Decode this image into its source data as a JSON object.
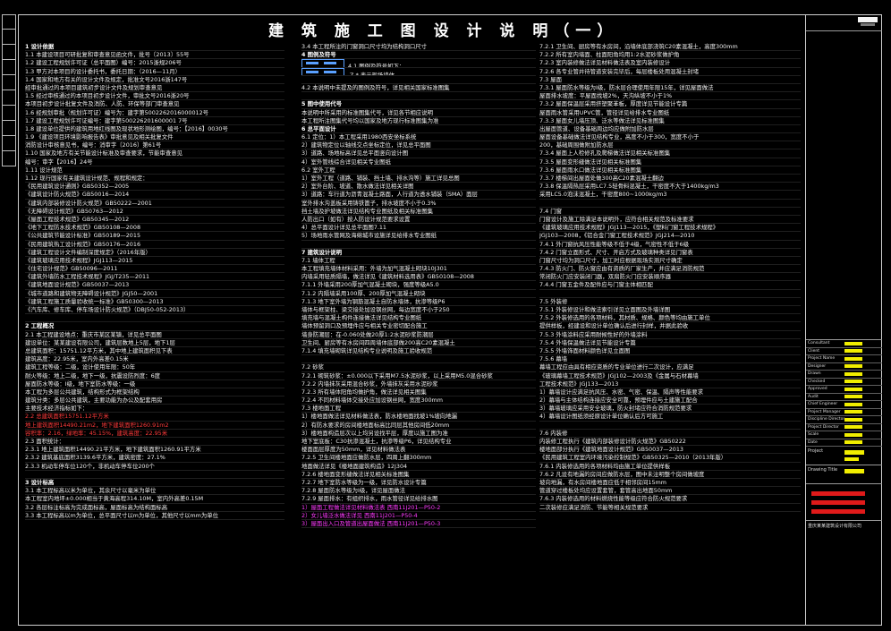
{
  "title": "建 筑 施 工 图 设 计 说 明（一）",
  "col1": [
    {
      "t": "1 设计依据",
      "c": "h"
    },
    {
      "t": "1.1 本建设项目可研批复和审查意见函文件，批号〔2013〕55号"
    },
    {
      "t": "1.2 建设工程规划许可证（总平面图）编号：2015浙规206号"
    },
    {
      "t": "1.3 甲方对本项目的设计委托书，委托日期：（2016—11月）"
    },
    {
      "t": "1.4 国家和地方有关的设计文件及规定，批准文号2016浙147号"
    },
    {
      "t": "  经审批通过的本项目建筑初步设计文件及规划审查意见"
    },
    {
      "t": "1.5 经过审核通过的本项目初步设计文件，审批文号2016浙20号"
    },
    {
      "t": "  本项目初步设计批复文件及消防、人防、环保等部门审查意见"
    },
    {
      "t": "1.6 经规划审批（规划许可证）编号为：建字第5002262016000012号"
    },
    {
      "t": "1.7 建设工程规划许可证编号：建字第500226201600001 7号"
    },
    {
      "t": "1.8 建设单位提供的建筑用地红线图及现状地形测绘图，编号：【2016】0030号"
    },
    {
      "t": "1.9 《建设项目环境影响报告表》审批意见及相关批复文件"
    },
    {
      "t": "  消防设计审核意见书，编号：消审字〔2016〕第61号"
    },
    {
      "t": "1.10 国家及地方有关节能设计标准及审查要求，节能审查意见"
    },
    {
      "t": "  编号：审字【2016】24号"
    },
    {
      "t": "1.11 设计规范"
    },
    {
      "t": "1.12 现行国家有关建筑设计规范、规程和规定："
    },
    {
      "t": "  《民用建筑设计通则》GB50352—2005"
    },
    {
      "t": "  《建筑设计防火规范》GB50016—2014"
    },
    {
      "t": "  《建筑内部装修设计防火规范》GB50222—2001"
    },
    {
      "t": "  《无障碍设计规范》GB50763—2012"
    },
    {
      "t": "  《屋面工程技术规范》GB50345—2012"
    },
    {
      "t": "  《地下工程防水技术规范》GB50108—2008"
    },
    {
      "t": "  《公共建筑节能设计标准》GB50189—2015"
    },
    {
      "t": "  《民用建筑热工设计规范》GB50176—2016"
    },
    {
      "t": "  《建筑工程设计文件编制深度规定》（2016年版）"
    },
    {
      "t": "  《建筑玻璃应用技术规程》JGJ113—2015"
    },
    {
      "t": "  《住宅设计规范》GB50096—2011"
    },
    {
      "t": "  《建筑外墙防水工程技术规程》JGJ/T235—2011"
    },
    {
      "t": "  《建筑地面设计规范》GB50037—2013"
    },
    {
      "t": "  《城市道路和建筑物无障碍设计规范》JGJ50—2001"
    },
    {
      "t": "  《建筑工程施工质量验收统一标准》GB50300—2013"
    },
    {
      "t": "  《汽车库、修车库、停车场设计防火规范》（DBJ50-052-2013）"
    },
    {
      "t": ""
    },
    {
      "t": "2 工程概况",
      "c": "h"
    },
    {
      "t": "2.1 本工程建设地点：重庆市某区某镇，详见总平面图"
    },
    {
      "t": "  建设单位：某某建设有限公司，建筑层数地上5层，地下1层"
    },
    {
      "t": "  总建筑面积：15751.12平方米，其中地上建筑面积见下表"
    },
    {
      "t": "  建筑高度：22.95米，室内外高差0.15米"
    },
    {
      "t": "  建筑工程等级：二级，设计使用年限：50年"
    },
    {
      "t": "  耐火等级：地上二级，地下一级，抗震设防烈度：6度"
    },
    {
      "t": "  屋面防水等级：Ⅰ级，地下室防水等级：一级"
    },
    {
      "t": "  本工程为多层公共建筑，结构形式为框架结构"
    },
    {
      "t": "  建筑分类：多层公共建筑，主要功能为办公及配套用房"
    },
    {
      "t": "  主要技术经济指标如下："
    },
    {
      "t": "2.2 总建筑面积15751.12平方米",
      "c": "r"
    },
    {
      "t": "  地上建筑面积14490.21m2，地下建筑面积1260.91m2",
      "c": "r"
    },
    {
      "t": "  容积率：2.16，绿地率：45.15%，建筑高度：22.95米",
      "c": "r"
    },
    {
      "t": "2.3 面积统计："
    },
    {
      "t": "  2.3.1 地上建筑面积14490.21平方米，地下建筑面积1260.91平方米"
    },
    {
      "t": "  2.3.2 建筑基底面积3139.6平方米，建筑密度：27.1%"
    },
    {
      "t": "  2.3.3 机动车停车位120个，非机动车停车位200个"
    },
    {
      "t": ""
    },
    {
      "t": "3 设计标高",
      "c": "h"
    },
    {
      "t": "3.1 本工程标高以米为单位，其余尺寸以毫米为单位"
    },
    {
      "t": "  本工程室内地坪±0.000相当于黄海高程314.10M，室内外高差0.15M"
    },
    {
      "t": "3.2 各层标注标高为完成面标高，屋面标高为结构面标高"
    },
    {
      "t": "3.3 本工程标高以m为单位，总平面尺寸以m为单位，其他尺寸以mm为单位"
    }
  ],
  "col2": [
    {
      "t": "3.4 本工程所注的门窗洞口尺寸均为结构洞口尺寸"
    },
    {
      "t": "4 图例及符号",
      "c": "h"
    },
    {
      "t": "4.1 图例及符号如下：",
      "sym": true
    },
    {
      "t": "  Z-* 表示现场墙体",
      "sym": true
    },
    {
      "t": ""
    },
    {
      "t": "4.2 本说明中未提及的图例及符号，详见相关国家标准图集"
    },
    {
      "t": ""
    },
    {
      "t": "5 图中使用代号",
      "c": "h"
    },
    {
      "t": "  本说明中所采用的标准图集代号，详见各节相应说明"
    },
    {
      "t": "  本工程所注图集代号均以国家及地方现行标准图集为准"
    },
    {
      "t": "6 总平面设计",
      "c": "h"
    },
    {
      "t": "6.1 定位：1）本工程采用1980西安坐标系统"
    },
    {
      "t": "  2）建筑物定位以轴线交点坐标定位，详见总平面图"
    },
    {
      "t": "  3）道路、场地标高详见总平面竖向设计图"
    },
    {
      "t": "  4）室外管线综合详见相关专业图纸"
    },
    {
      "t": "6.2 室外工程"
    },
    {
      "t": "  1）室外工程（道路、铺装、挡土墙、排水沟等）施工详见总图"
    },
    {
      "t": "  2）室外台阶、坡道、散水做法详见相关详图"
    },
    {
      "t": "  3）道路：车行道为沥青混凝土路面，人行道为透水铺装（SMA）面层"
    },
    {
      "t": "  室外排水沟盖板采用铸铁篦子，排水坡度不小于0.3%"
    },
    {
      "t": "  挡土墙及护坡做法详见结构专业图纸及相关标准图集"
    },
    {
      "t": "  人防出口（如有）按人防设计规范要求设置"
    },
    {
      "t": "  4）总平面设计详见总平面图7.11"
    },
    {
      "t": "  5）场地雨水管网及海绵城市设施详见给排水专业图纸"
    },
    {
      "t": ""
    },
    {
      "t": "7 建筑设计说明",
      "c": "h"
    },
    {
      "t": "7.1 墙体工程"
    },
    {
      "t": "  本工程填充墙体材料采用：外墙为加气混凝土砌块10J301"
    },
    {
      "t": "  内墙采用轻质隔墙，做法详见《建筑材料选用表》GB50108—2008"
    },
    {
      "t": "7.1.1 外墙采用200厚加气混凝土砌块，强度等级A5.0"
    },
    {
      "t": "7.1.2 内隔墙采用100厚、200厚加气混凝土砌块"
    },
    {
      "t": "7.1.3 地下室外墙为钢筋混凝土自防水墙体，抗渗等级P6"
    },
    {
      "t": "  墙体与框架柱、梁交接处加设钢丝网，每边宽度不小于250"
    },
    {
      "t": "  填充墙与混凝土构件连接做法详见结构专业图纸"
    },
    {
      "t": "  墙体预留洞口及预埋件应与相关专业密切配合施工"
    },
    {
      "t": "  墙身防潮层：在-0.060处做20厚1:2水泥砂浆防潮层"
    },
    {
      "t": "  卫生间、厨房等有水房间四周墙体底部做200高C20素混凝土"
    },
    {
      "t": "7.1.4 填充墙砌筑详见结构专业说明及施工验收规范"
    },
    {
      "t": ""
    },
    {
      "t": "7.2 砂浆"
    },
    {
      "t": "7.2.1 砌筑砂浆：±0.000以下采用M7.5水泥砂浆，以上采用M5.0混合砂浆"
    },
    {
      "t": "7.2.2 内墙抹灰采用混合砂浆，外墙抹灰采用水泥砂浆"
    },
    {
      "t": "7.2.3 所有墙体阳角均做护角，做法详见相关图集"
    },
    {
      "t": "7.2.4 不同材料墙体交接处应加设钢丝网，宽度300mm"
    },
    {
      "t": "7.3 楼地面工程"
    },
    {
      "t": "  1）楼地面做法详见材料做法表，防水楼地面找坡1%坡向地漏"
    },
    {
      "t": "  2）有防水要求的房间楼地面标高比同层其他房间低20mm"
    },
    {
      "t": "  3）楼地面构造层次以上均另设找平层，厚度以施工图为准"
    },
    {
      "t": "  地下室底板：C30抗渗混凝土，抗渗等级P6，详见结构专业"
    },
    {
      "t": "  楼面面层厚度为50mm，详见材料做法表"
    },
    {
      "t": "7.2.5 卫生间楼地面应做防水层，四周上翻300mm"
    },
    {
      "t": "  地面做法详见《楼地面建筑构造》12J304"
    },
    {
      "t": "7.2.6 楼地面变形缝做法详见相关标准图集"
    },
    {
      "t": "7.2.7 地下室防水等级为一级，详见防水设计专篇"
    },
    {
      "t": "7.2.8 屋面防水等级为Ⅰ级，详见屋面做法"
    },
    {
      "t": "7.2.9 屋面排水：有组织排水，雨水管径详见给排水图"
    },
    {
      "t": "  1）屋面工程做法详见材料做法表 西南11J201—P50-2",
      "c": "m"
    },
    {
      "t": "  2）女儿墙泛水做法详见 西南11J201—P50-4",
      "c": "m"
    },
    {
      "t": "  3）屋面出入口及管道出屋面做法 西南11J201—P50-3",
      "c": "m"
    }
  ],
  "col3": [
    {
      "t": "7.2.1 卫生间、厨房等有水房间，沿墙体底部浇筑C20素混凝土，高度300mm"
    },
    {
      "t": "7.2.2 所有室内墙面、柱面阳角均用1:2水泥砂浆做护角"
    },
    {
      "t": "7.2.3 室内装修做法详见材料做法表及室内装修设计"
    },
    {
      "t": "7.2.6 各专业管井待管道安装完毕后，每层楼板处用混凝土封堵"
    },
    {
      "t": "7.3 屋面"
    },
    {
      "t": "7.3.1 屋面防水等级为Ⅰ级，防水层合理使用年限15年，详见屋面做法"
    },
    {
      "t": "  屋面排水坡度：平屋面找坡2%，天沟纵坡不小于1%"
    },
    {
      "t": "7.3.2 屋面保温层采用挤塑聚苯板，厚度详见节能设计专篇"
    },
    {
      "t": "  屋面雨水管采用UPVC管，管径详见给排水专业图纸"
    },
    {
      "t": "7.3.3 屋面女儿墙压顶、泛水等做法详见标准图集"
    },
    {
      "t": "  出屋面管道、设备基础周边均应做附加防水层"
    },
    {
      "t": "  屋面设备基础做法详见结构专业，高度不小于300，宽度不小于"
    },
    {
      "t": "  200，基础周围做附加防水层"
    },
    {
      "t": "7.3.4 屋面上人检修孔及爬梯做法详见相关标准图集"
    },
    {
      "t": "7.3.5 屋面变形缝做法详见相关标准图集"
    },
    {
      "t": "7.3.6 屋面雨水口做法详见相关标准图集"
    },
    {
      "t": "7.3.7 楼梯间出屋面处做300高C20素混凝土翻边"
    },
    {
      "t": "7.3.8 保温隔热层采用LC7.5轻骨料混凝土，干密度不大于1400kg/m3"
    },
    {
      "t": "  采用LC5.0泡沫混凝土，干密度800~1000kg/m3"
    },
    {
      "t": ""
    },
    {
      "t": "7.4 门窗"
    },
    {
      "t": "  门窗设计及施工除满足本说明外，应符合相关规范及标准要求"
    },
    {
      "t": "  《建筑玻璃应用技术规程》JGJ113—2015，《塑料门窗工程技术规程》"
    },
    {
      "t": "  JGJ103—2008，《铝合金门窗工程技术规范》JGJ214—2010"
    },
    {
      "t": "7.4.1 外门窗抗风压性能等级不低于4级，气密性不低于6级"
    },
    {
      "t": "7.4.2 门窗立面形式、尺寸、开启方式及玻璃种类详见门窗表"
    },
    {
      "t": "  门窗尺寸均为洞口尺寸，加工时应根据现场实测尺寸确定"
    },
    {
      "t": "7.4.3 防火门、防火窗应由有资质的厂家生产，并应满足消防规范"
    },
    {
      "t": "  常闭防火门应安装闭门器，双扇防火门应安装顺序器"
    },
    {
      "t": "7.4.4 门窗五金件及配件应与门窗主体相匹配"
    },
    {
      "t": ""
    },
    {
      "t": "7.5 外装修"
    },
    {
      "t": "7.5.1 外装修设计和做法索引详见立面图及外墙详图"
    },
    {
      "t": "7.5.2 外装修选用的各项材料，其材质、规格、颜色等均由施工单位"
    },
    {
      "t": "  提供样板，经建设和设计单位确认后进行封样，并据此验收"
    },
    {
      "t": "7.5.3 外墙涂料应采用耐候性好的外墙涂料"
    },
    {
      "t": "7.5.4 外墙保温做法详见节能设计专篇"
    },
    {
      "t": "7.5.5 外墙饰面材料颜色详见立面图"
    },
    {
      "t": "7.5.6 幕墙"
    },
    {
      "t": "  幕墙工程应由具有相应资质的专业单位进行二次设计，应满足"
    },
    {
      "t": "  《玻璃幕墙工程技术规范》JGJ102—2003及《金属与石材幕墙"
    },
    {
      "t": "  工程技术规范》JGJ133—2013"
    },
    {
      "t": "  1）幕墙设计应满足抗风压、水密、气密、保温、隔声等性能要求"
    },
    {
      "t": "  2）幕墙与主体结构连接应安全可靠，预埋件应与土建施工配合"
    },
    {
      "t": "  3）幕墙玻璃应采用安全玻璃，防火封堵应符合消防规范要求"
    },
    {
      "t": "  4）幕墙设计图纸须经原设计单位确认后方可施工"
    },
    {
      "t": ""
    },
    {
      "t": "7.6 内装修"
    },
    {
      "t": "  内装修工程执行《建筑内部装修设计防火规范》GB50222"
    },
    {
      "t": "  楼地面部分执行《建筑地面设计规范》GB50037—2013"
    },
    {
      "t": "  《民用建筑工程室内环境污染控制规范》GB50325—2010（2013年版）"
    },
    {
      "t": "7.6.1 内装修选用的各项材料均由施工单位提供样板"
    },
    {
      "t": "7.6.2 凡设有地漏的房间应做防水层，图中未注明整个房间做坡度"
    },
    {
      "t": "  坡向地漏，有水房间楼地面应低于相邻房间15mm"
    },
    {
      "t": "  管道穿过楼板处均应设置套管，套管高出地面50mm"
    },
    {
      "t": "7.6.3 内装修选用的材料燃烧性能等级应符合防火规范要求"
    },
    {
      "t": "  二次装修应满足消防、节能等相关规范要求"
    }
  ],
  "title_block": {
    "rows": [
      "Consultant",
      "Client",
      "Project Name",
      "Designer",
      "Drawn",
      "Checked",
      "Approved",
      "Audit",
      "Chief Engineer",
      "Project Manager",
      "Discipline Director",
      "Project Director",
      "Scale",
      "Date"
    ],
    "proj_label": "Project",
    "drawing_label": "Drawing Title",
    "footer": "重庆某某建筑设计有限公司"
  }
}
